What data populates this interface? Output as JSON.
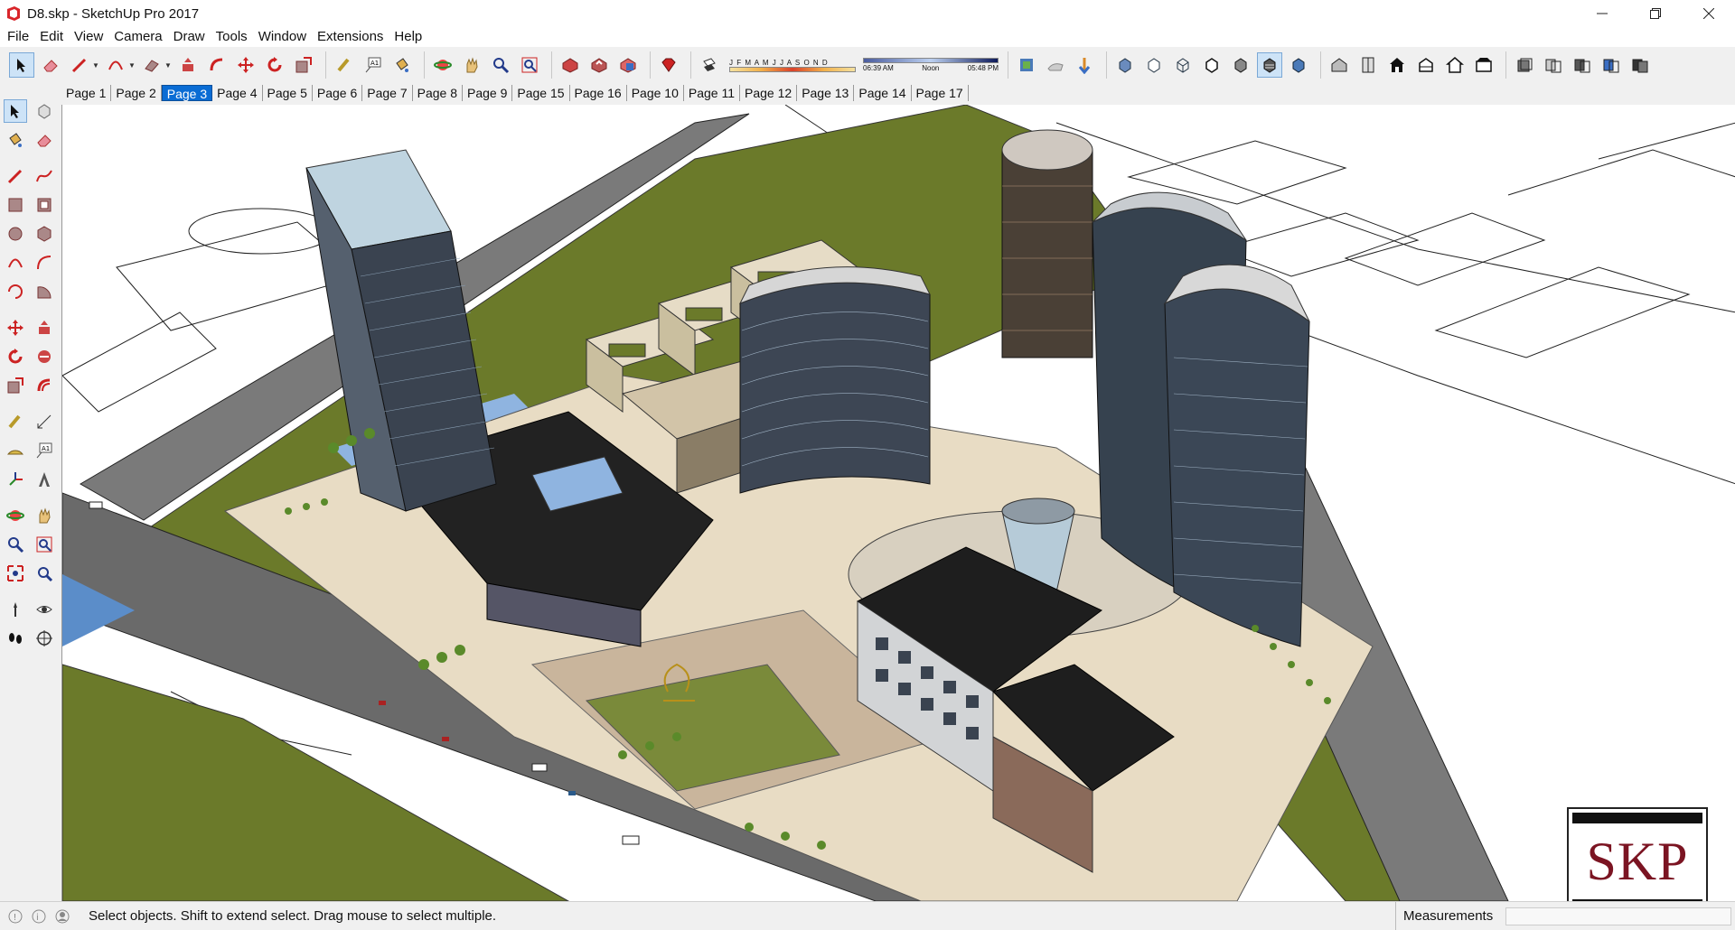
{
  "window": {
    "title": "D8.skp - SketchUp Pro 2017",
    "controls": [
      "minimize-icon",
      "restore-icon",
      "close-icon"
    ]
  },
  "menu": [
    "File",
    "Edit",
    "View",
    "Camera",
    "Draw",
    "Tools",
    "Window",
    "Extensions",
    "Help"
  ],
  "shadow_settings": {
    "months": "J F M A M J J A S O N D",
    "time_start": "06:39 AM",
    "time_mid": "Noon",
    "time_end": "05:48 PM"
  },
  "page_tabs": [
    "Page 1",
    "Page 2",
    "Page 3",
    "Page 4",
    "Page 5",
    "Page 6",
    "Page 7",
    "Page 8",
    "Page 9",
    "Page 15",
    "Page 16",
    "Page 10",
    "Page 11",
    "Page 12",
    "Page 13",
    "Page 14",
    "Page 17"
  ],
  "active_tab": "Page 3",
  "watermark": "SKP",
  "status": {
    "message": "Select objects. Shift to extend select. Drag mouse to select multiple.",
    "measurements_label": "Measurements",
    "measurements_value": ""
  },
  "colors": {
    "selection": "#0a6cd4",
    "lawn": "#6b7a2a",
    "road": "#6a6a6a",
    "plaza": "#e8dcc4",
    "logo_text": "#7b1422"
  }
}
